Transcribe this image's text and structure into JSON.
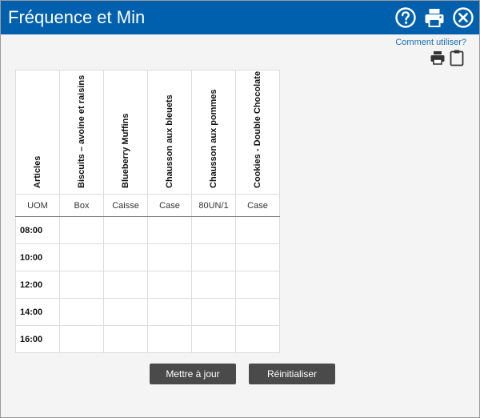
{
  "window": {
    "title": "Fréquence et Min"
  },
  "help_link": "Comment utiliser?",
  "icons": {
    "help": "help-icon",
    "print": "print-icon",
    "close": "close-icon",
    "clipboard": "clipboard-icon"
  },
  "colors": {
    "titlebar": "#0060ae",
    "button": "#4a4a4a",
    "link": "#1a6fb3"
  },
  "grid": {
    "columns": [
      "Articles",
      "Biscuits – avoine et raisins",
      "Blueberry Muffins",
      "Chausson aux bleuets",
      "Chausson aux pommes",
      "Cookies - Double Chocolate"
    ],
    "uom": [
      "UOM",
      "Box",
      "Caisse",
      "Case",
      "80UN/1",
      "Case"
    ],
    "times": [
      "08:00",
      "10:00",
      "12:00",
      "14:00",
      "16:00"
    ]
  },
  "buttons": {
    "update": "Mettre à jour",
    "reset": "Réinitialiser"
  }
}
